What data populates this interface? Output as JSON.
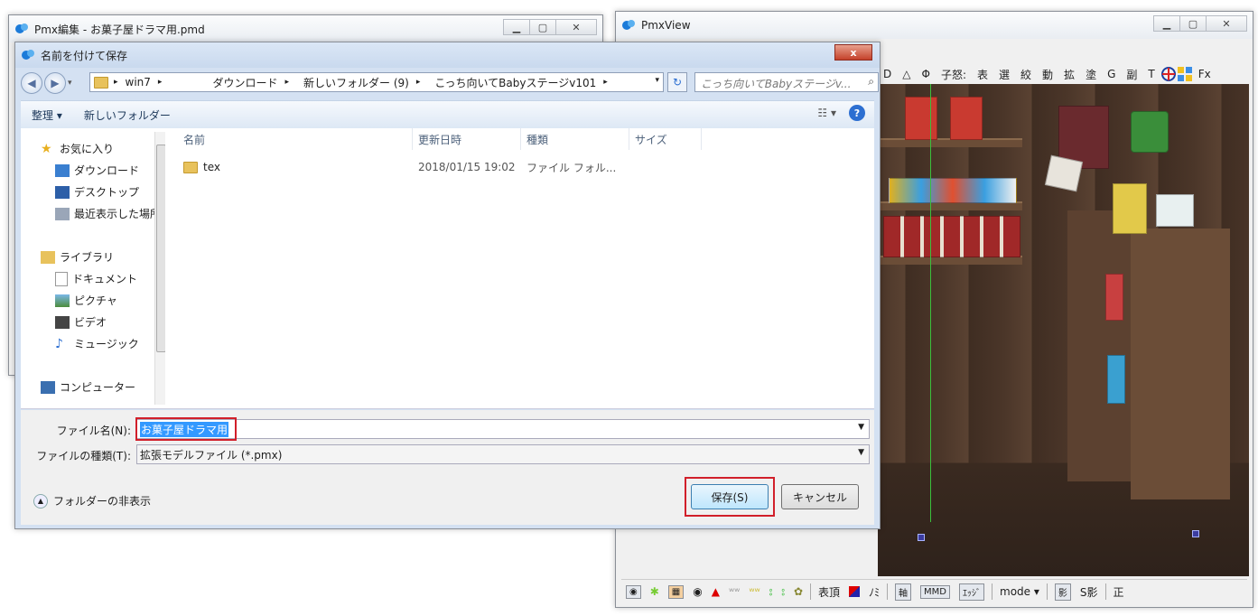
{
  "editor_window": {
    "title": "Pmx編集 - お菓子屋ドラマ用.pmd"
  },
  "viewer_window": {
    "title": "PmxView",
    "toolbar_items": [
      "D",
      "△",
      "Φ",
      "子怒:",
      "表",
      "選",
      "絞",
      "動",
      "拡",
      "塗",
      "G",
      "副",
      "T",
      "Fx"
    ],
    "statusbar": {
      "items_a": [
        "表頂"
      ],
      "item_nomi": "ﾉﾐ",
      "box_items": [
        "軸",
        "MMD",
        "ｴｯｼﾞ"
      ],
      "mode_label": "mode",
      "kage": "影",
      "skage": "S影",
      "sei": "正"
    }
  },
  "dialog": {
    "title": "名前を付けて保存",
    "breadcrumb": [
      "win7",
      "ダウンロード",
      "新しいフォルダー (9)",
      "こっち向いてBabyステージv101"
    ],
    "search_placeholder": "こっち向いてBabyステージv...",
    "commands": {
      "organize": "整理",
      "new_folder": "新しいフォルダー"
    },
    "nav": {
      "favorites": "お気に入り",
      "favorites_items": [
        "ダウンロード",
        "デスクトップ",
        "最近表示した場所"
      ],
      "libraries": "ライブラリ",
      "library_items": [
        "ドキュメント",
        "ピクチャ",
        "ビデオ",
        "ミュージック"
      ],
      "computer": "コンピューター"
    },
    "columns": {
      "name": "名前",
      "modified": "更新日時",
      "type": "種類",
      "size": "サイズ"
    },
    "files": [
      {
        "name": "tex",
        "modified": "2018/01/15 19:02",
        "type": "ファイル フォル..."
      }
    ],
    "filename_label": "ファイル名(N):",
    "filename_value": "お菓子屋ドラマ用",
    "filetype_label": "ファイルの種類(T):",
    "filetype_value": "拡張モデルファイル (*.pmx)",
    "hide_folders": "フォルダーの非表示",
    "save_button": "保存(S)",
    "cancel_button": "キャンセル",
    "close_glyph": "x"
  },
  "icons": {
    "app": "pmx-app-icon",
    "folder": "folder-icon",
    "search": "search-icon"
  }
}
